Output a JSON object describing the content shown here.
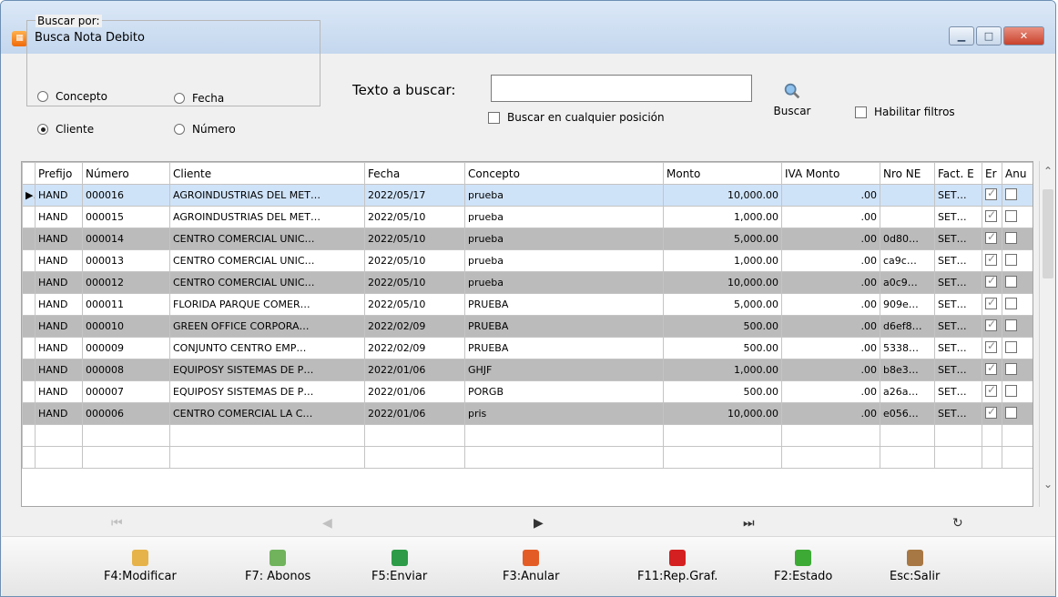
{
  "window": {
    "title": "Busca Nota Debito",
    "controls": [
      "minimize",
      "maximize",
      "close"
    ]
  },
  "search": {
    "group_label": "Buscar por:",
    "options": [
      {
        "label": "Concepto",
        "selected": false
      },
      {
        "label": "Fecha",
        "selected": false
      },
      {
        "label": "Cliente",
        "selected": true
      },
      {
        "label": "Número",
        "selected": false
      }
    ],
    "text_label": "Texto a buscar:",
    "text_value": "",
    "anywhere_label": "Buscar en cualquier posición",
    "anywhere_checked": false,
    "search_button": "Buscar",
    "filters_label": "Habilitar filtros",
    "filters_checked": false
  },
  "table": {
    "headers": [
      "Prefijo",
      "Número",
      "Cliente",
      "Fecha",
      "Concepto",
      "Monto",
      "IVA Monto",
      "Nro NE",
      "Fact. E",
      "Er",
      "Anu"
    ],
    "rows": [
      {
        "prefijo": "HAND",
        "numero": "000016",
        "cliente": "AGROINDUSTRIAS DEL MET…",
        "fecha": "2022/05/17",
        "concepto": "prueba",
        "monto": "10,000.00",
        "iva": ".00",
        "nro": "",
        "fact": "SET…",
        "er": true,
        "anu": false
      },
      {
        "prefijo": "HAND",
        "numero": "000015",
        "cliente": "AGROINDUSTRIAS DEL MET…",
        "fecha": "2022/05/10",
        "concepto": "prueba",
        "monto": "1,000.00",
        "iva": ".00",
        "nro": "",
        "fact": "SET…",
        "er": true,
        "anu": false
      },
      {
        "prefijo": "HAND",
        "numero": "000014",
        "cliente": "CENTRO COMERCIAL UNIC…",
        "fecha": "2022/05/10",
        "concepto": "prueba",
        "monto": "5,000.00",
        "iva": ".00",
        "nro": "0d80…",
        "fact": "SET…",
        "er": true,
        "anu": false
      },
      {
        "prefijo": "HAND",
        "numero": "000013",
        "cliente": "CENTRO COMERCIAL UNIC…",
        "fecha": "2022/05/10",
        "concepto": "prueba",
        "monto": "1,000.00",
        "iva": ".00",
        "nro": "ca9c…",
        "fact": "SET…",
        "er": true,
        "anu": false
      },
      {
        "prefijo": "HAND",
        "numero": "000012",
        "cliente": "CENTRO COMERCIAL UNIC…",
        "fecha": "2022/05/10",
        "concepto": "prueba",
        "monto": "10,000.00",
        "iva": ".00",
        "nro": "a0c9…",
        "fact": "SET…",
        "er": true,
        "anu": false
      },
      {
        "prefijo": "HAND",
        "numero": "000011",
        "cliente": "FLORIDA PARQUE COMER…",
        "fecha": "2022/05/10",
        "concepto": "PRUEBA",
        "monto": "5,000.00",
        "iva": ".00",
        "nro": "909e…",
        "fact": "SET…",
        "er": true,
        "anu": false
      },
      {
        "prefijo": "HAND",
        "numero": "000010",
        "cliente": "GREEN OFFICE CORPORA…",
        "fecha": "2022/02/09",
        "concepto": "PRUEBA",
        "monto": "500.00",
        "iva": ".00",
        "nro": "d6ef8…",
        "fact": "SET…",
        "er": true,
        "anu": false
      },
      {
        "prefijo": "HAND",
        "numero": "000009",
        "cliente": "CONJUNTO CENTRO EMP…",
        "fecha": "2022/02/09",
        "concepto": "PRUEBA",
        "monto": "500.00",
        "iva": ".00",
        "nro": "5338…",
        "fact": "SET…",
        "er": true,
        "anu": false
      },
      {
        "prefijo": "HAND",
        "numero": "000008",
        "cliente": "EQUIPOSY SISTEMAS DE P…",
        "fecha": "2022/01/06",
        "concepto": "GHJF",
        "monto": "1,000.00",
        "iva": ".00",
        "nro": "b8e3…",
        "fact": "SET…",
        "er": true,
        "anu": false
      },
      {
        "prefijo": "HAND",
        "numero": "000007",
        "cliente": "EQUIPOSY SISTEMAS DE P…",
        "fecha": "2022/01/06",
        "concepto": "PORGB",
        "monto": "500.00",
        "iva": ".00",
        "nro": "a26a…",
        "fact": "SET…",
        "er": true,
        "anu": false
      },
      {
        "prefijo": "HAND",
        "numero": "000006",
        "cliente": "CENTRO COMERCIAL LA C…",
        "fecha": "2022/01/06",
        "concepto": "pris",
        "monto": "10,000.00",
        "iva": ".00",
        "nro": "e056…",
        "fact": "SET…",
        "er": true,
        "anu": false
      }
    ]
  },
  "nav": {
    "icons": [
      "first-record",
      "previous-record",
      "next-record",
      "last-record",
      "refresh"
    ]
  },
  "toolbar": {
    "items": [
      {
        "label": "F4:Modificar",
        "icon": "edit-icon",
        "color": "#e6b34a"
      },
      {
        "label": "F7: Abonos",
        "icon": "money-icon",
        "color": "#70b35c"
      },
      {
        "label": "F5:Enviar",
        "icon": "send-icon",
        "color": "#2d9b47"
      },
      {
        "label": "F3:Anular",
        "icon": "cancel-document-icon",
        "color": "#e45c25"
      },
      {
        "label": "F11:Rep.Graf.",
        "icon": "pdf-icon",
        "color": "#d42020"
      },
      {
        "label": "F2:Estado",
        "icon": "status-check-icon",
        "color": "#3daa35"
      },
      {
        "label": "Esc:Salir",
        "icon": "exit-door-icon",
        "color": "#a77843"
      }
    ]
  }
}
